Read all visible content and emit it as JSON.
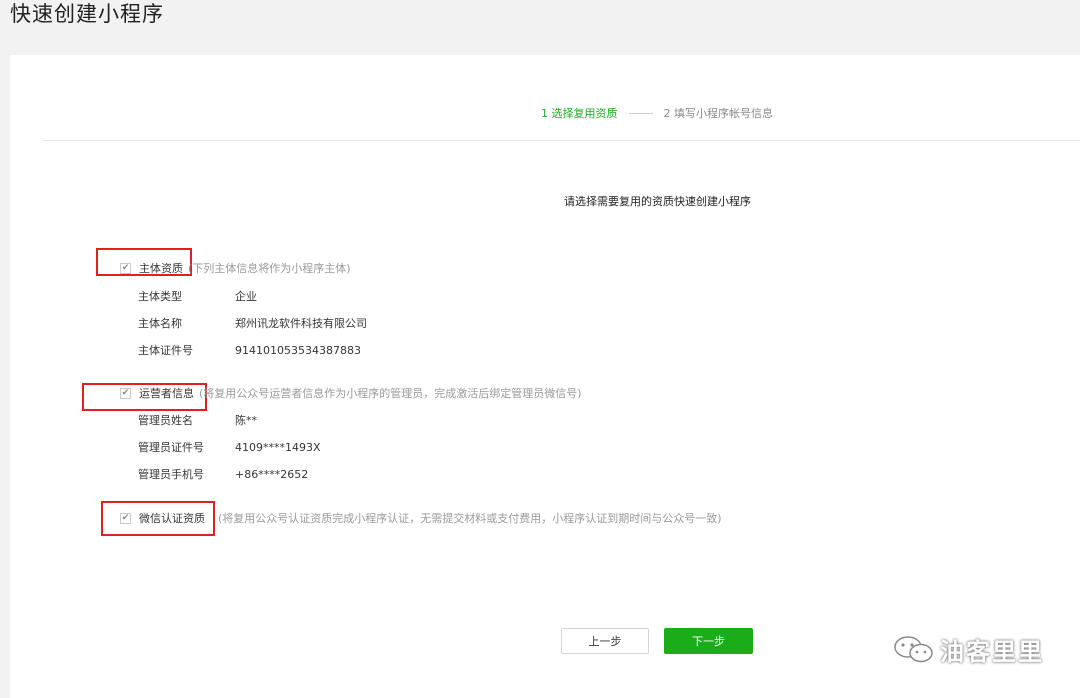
{
  "page": {
    "title": "快速创建小程序"
  },
  "steps": {
    "step1": "1 选择复用资质",
    "step2": "2 填写小程序帐号信息"
  },
  "subtitle": "请选择需要复用的资质快速创建小程序",
  "sections": {
    "subject": {
      "label": "主体资质",
      "note": "(下列主体信息将作为小程序主体)",
      "checked": true,
      "rows": [
        {
          "key": "主体类型",
          "value": "企业"
        },
        {
          "key": "主体名称",
          "value": "郑州讯龙软件科技有限公司"
        },
        {
          "key": "主体证件号",
          "value": "914101053534387883"
        }
      ]
    },
    "operator": {
      "label": "运营者信息",
      "note": "(将复用公众号运营者信息作为小程序的管理员，完成激活后绑定管理员微信号)",
      "checked": true,
      "rows": [
        {
          "key": "管理员姓名",
          "value": "陈**"
        },
        {
          "key": "管理员证件号",
          "value": "4109****1493X"
        },
        {
          "key": "管理员手机号",
          "value": "+86****2652"
        }
      ]
    },
    "wechat_cert": {
      "label": "微信认证资质",
      "note": "(将复用公众号认证资质完成小程序认证，无需提交材料或支付费用，小程序认证到期时间与公众号一致)",
      "checked": true
    }
  },
  "buttons": {
    "prev": "上一步",
    "next": "下一步"
  },
  "watermark": {
    "text": "油客里里",
    "icon": "wechat-icon"
  },
  "colors": {
    "accent": "#1aad19",
    "highlight": "#e02020"
  }
}
